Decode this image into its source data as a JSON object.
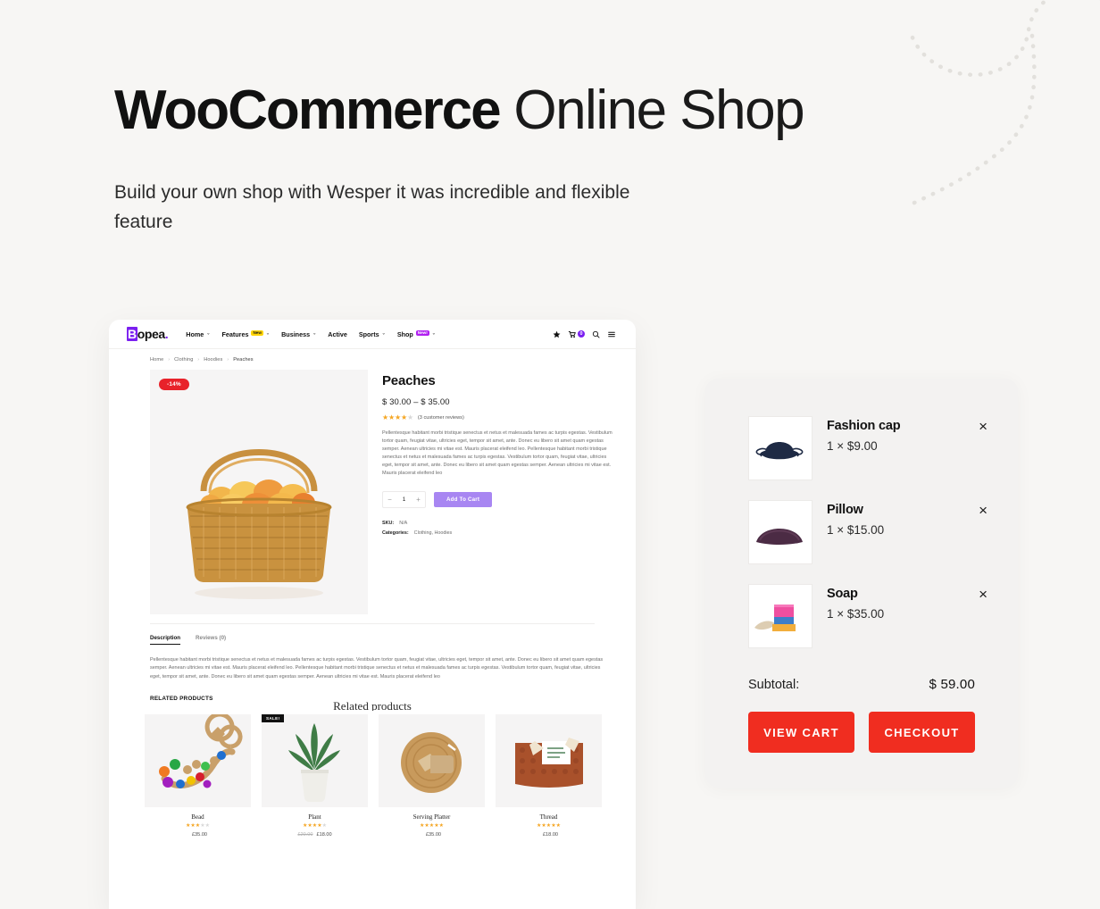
{
  "hero": {
    "title_strong": "WooCommerce",
    "title_light": " Online Shop",
    "subtitle": "Build your own shop with Wesper it was incredible and flexible feature"
  },
  "site": {
    "logo": {
      "first": "B",
      "rest": "opea",
      "dot": "."
    },
    "nav": [
      {
        "label": "Home",
        "caret": "⌄",
        "badge": "",
        "badge_type": ""
      },
      {
        "label": "Features",
        "caret": "⌄",
        "badge": "New",
        "badge_type": "new"
      },
      {
        "label": "Business",
        "caret": "⌄",
        "badge": "",
        "badge_type": ""
      },
      {
        "label": "Active",
        "caret": "",
        "badge": "",
        "badge_type": ""
      },
      {
        "label": "Sports",
        "caret": "⌄",
        "badge": "",
        "badge_type": ""
      },
      {
        "label": "Shop",
        "caret": "⌄",
        "badge": "New!",
        "badge_type": "hot"
      }
    ],
    "icons": {
      "star": "star-icon",
      "cart": "cart-icon",
      "cart_count": "0",
      "search": "search-icon",
      "menu": "hamburger-menu-icon"
    },
    "breadcrumb": [
      "Home",
      "Clothing",
      "Hoodies",
      "Peaches"
    ],
    "breadcrumb_sep": "›"
  },
  "product": {
    "sale_badge": "-14%",
    "title": "Peaches",
    "price": "$ 30.00 – $ 35.00",
    "stars_filled": 4,
    "stars_total": 5,
    "reviews_note": "(3 customer reviews)",
    "description": "Pellentesque habitant morbi tristique senectus et netus et malesuada fames ac turpis egestas. Vestibulum tortor quam, feugiat vitae, ultricies eget, tempor sit amet, ante. Donec eu libero sit amet quam egestas semper. Aenean ultricies mi vitae est. Mauris placerat eleifend leo. Pellentesque habitant morbi tristique senectus et netus et malesuada fames ac turpis egestas. Vestibulum tortor quam, feugiat vitae, ultricies eget, tempor sit amet, ante. Donec eu libero sit amet quam egestas semper. Aenean ultricies mi vitae est. Mauris placerat eleifend leo",
    "qty_minus": "−",
    "qty_value": "1",
    "qty_plus": "+",
    "add_to_cart": "Add To Cart",
    "sku_label": "SKU:",
    "sku_value": "N/A",
    "categories_label": "Categories:",
    "categories_value": "Clothing, Hoodies"
  },
  "tabs": [
    {
      "label": "Description",
      "active": true
    },
    {
      "label": "Reviews (0)",
      "active": false
    }
  ],
  "tab_body": "Pellentesque habitant morbi tristique senectus et netus et malesuada fames ac turpis egestas. Vestibulum tortor quam, feugiat vitae, ultricies eget, tempor sit amet, ante. Donec eu libero sit amet quam egestas semper. Aenean ultricies mi vitae est. Mauris placerat eleifend leo. Pellentesque habitant morbi tristique senectus et netus et malesuada fames ac turpis egestas. Vestibulum tortor quam, feugiat vitae, ultricies eget, tempor sit amet, ante. Donec eu libero sit amet quam egestas semper. Aenean ultricies mi vitae est. Mauris placerat eleifend leo",
  "related": {
    "section_label": "RELATED PRODUCTS",
    "section_title": "Related products",
    "items": [
      {
        "name": "Bead",
        "stars_filled": 3,
        "price": "£35.00",
        "old_price": "",
        "sale": ""
      },
      {
        "name": "Plant",
        "stars_filled": 4,
        "price": "£18.00",
        "old_price": "£20.00",
        "sale": "SALE!"
      },
      {
        "name": "Serving Platter",
        "stars_filled": 5,
        "price": "£35.00",
        "old_price": "",
        "sale": ""
      },
      {
        "name": "Thread",
        "stars_filled": 5,
        "price": "£18.00",
        "old_price": "",
        "sale": ""
      }
    ]
  },
  "cart": {
    "items": [
      {
        "name": "Fashion cap",
        "qty": "1 × $9.00",
        "remove": "×"
      },
      {
        "name": "Pillow",
        "qty": "1 × $15.00",
        "remove": "×"
      },
      {
        "name": "Soap",
        "qty": "1 × $35.00",
        "remove": "×"
      }
    ],
    "subtotal_label": "Subtotal:",
    "subtotal_value": "$ 59.00",
    "view_cart": "VIEW CART",
    "checkout": "CHECKOUT"
  },
  "colors": {
    "page_bg": "#f7f6f4",
    "brand_purple": "#7b1ff0",
    "add_to_cart": "#a886f2",
    "sale_red": "#e8222a",
    "action_red": "#f02d20",
    "badge_yellow": "#ffd400",
    "star_gold": "#f5a623"
  }
}
